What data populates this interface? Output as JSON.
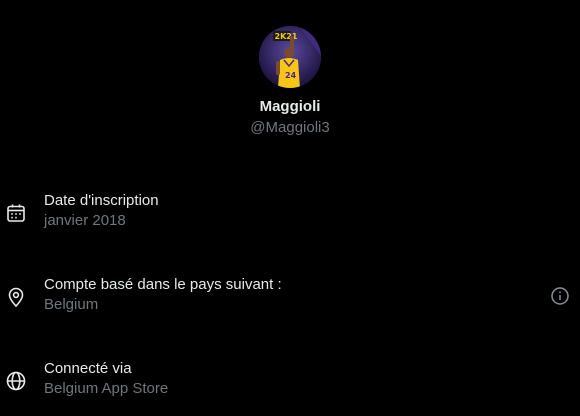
{
  "profile": {
    "display_name": "Maggioli",
    "handle": "@Maggioli3",
    "avatar_icon": "avatar-2k21-basketball"
  },
  "account_info": [
    {
      "label": "Date d'inscription",
      "value": "janvier 2018",
      "icon": "calendar-icon"
    },
    {
      "label": "Compte basé dans le pays suivant :",
      "value": "Belgium",
      "icon": "location-pin-icon",
      "action_icon": "info-icon"
    },
    {
      "label": "Connecté via",
      "value": "Belgium App Store",
      "icon": "globe-icon"
    }
  ],
  "colors": {
    "background": "#000000",
    "primary_text": "#e7e9ea",
    "secondary_text": "#71767b",
    "avatar_jersey": "#f5c518",
    "avatar_background": "#2a2250"
  }
}
